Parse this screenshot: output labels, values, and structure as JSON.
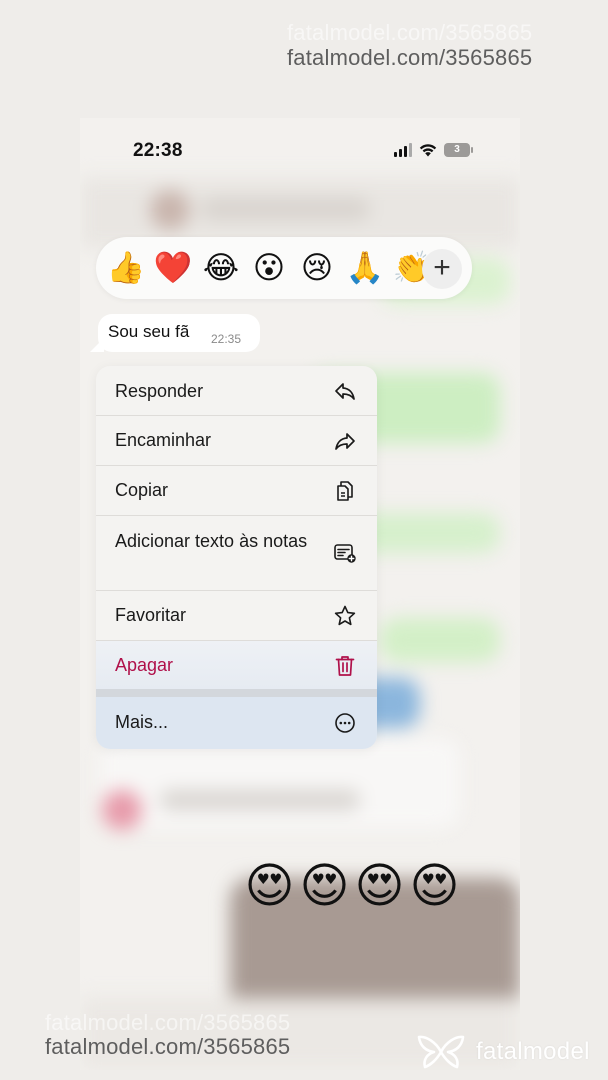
{
  "status_bar": {
    "time": "22:38",
    "battery": "3"
  },
  "reactions": {
    "items": [
      {
        "name": "thumbs-up",
        "glyph": "👍"
      },
      {
        "name": "red-heart",
        "glyph": "❤️"
      },
      {
        "name": "tears-of-joy",
        "glyph": "😂"
      },
      {
        "name": "surprised-face",
        "glyph": "😮"
      },
      {
        "name": "crying-face",
        "glyph": "😢"
      },
      {
        "name": "folded-hands",
        "glyph": "🙏"
      },
      {
        "name": "clapping-hands",
        "glyph": "👏"
      }
    ],
    "more_symbol": "+"
  },
  "message": {
    "text": "Sou seu fã",
    "time": "22:35"
  },
  "menu": {
    "items": [
      {
        "label": "Responder",
        "icon": "reply-icon"
      },
      {
        "label": "Encaminhar",
        "icon": "forward-icon"
      },
      {
        "label": "Copiar",
        "icon": "copy-icon"
      },
      {
        "label": "Adicionar texto às notas",
        "icon": "add-to-notes-icon"
      },
      {
        "label": "Favoritar",
        "icon": "star-icon"
      },
      {
        "label": "Apagar",
        "icon": "trash-icon",
        "color": "#b0104a"
      },
      {
        "label": "Mais...",
        "icon": "more-icon"
      }
    ]
  },
  "big_emojis": [
    "😍",
    "😍",
    "😍",
    "😍"
  ],
  "watermark": {
    "url": "fatalmodel.com/3565865",
    "brand": "fatalmodel"
  }
}
